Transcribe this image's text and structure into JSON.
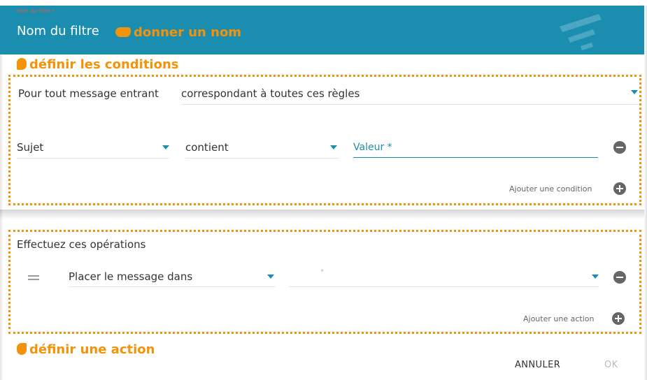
{
  "header": {
    "field_label": "Nom du filtre *",
    "filter_name": "Nom du filtre"
  },
  "annotations": {
    "name": "donner un nom",
    "conditions": "définir les conditions",
    "action": "définir une action"
  },
  "conditions": {
    "for_each_label": "Pour tout message entrant",
    "match_select": "correspondant à toutes ces règles",
    "rule": {
      "field": "Sujet",
      "operator": "contient",
      "value_placeholder": "Valeur *"
    },
    "add_label": "Ajouter une condition"
  },
  "actions": {
    "title": "Effectuez ces opérations",
    "action_select": "Placer le message dans",
    "target_placeholder": "*",
    "add_label": "Ajouter une action"
  },
  "footer": {
    "cancel": "ANNULER",
    "ok": "OK"
  },
  "colors": {
    "header_bg": "#1b8eb0",
    "annotation": "#f3920b",
    "accent": "#1b8eb0"
  }
}
